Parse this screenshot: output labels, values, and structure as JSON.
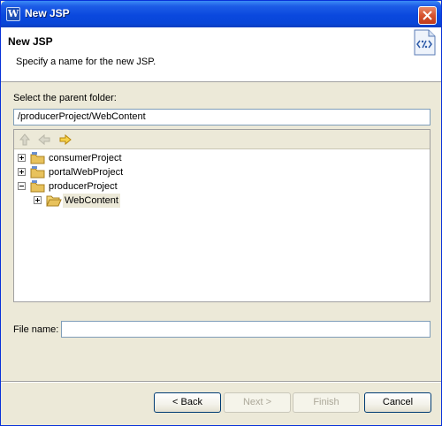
{
  "window": {
    "title": "New JSP",
    "app_icon_letter": "W",
    "close_icon": "close-icon"
  },
  "banner": {
    "title": "New JSP",
    "description": "Specify a name for the new JSP.",
    "icon": "jsp-file-icon"
  },
  "parent_folder": {
    "label": "Select the parent folder:",
    "value": "/producerProject/WebContent"
  },
  "tree": {
    "toolbar": {
      "up_icon": "up-arrow-icon",
      "back_icon": "back-arrow-icon",
      "forward_icon": "forward-arrow-icon"
    },
    "items": [
      {
        "label": "consumerProject",
        "expanded": false,
        "level": 0
      },
      {
        "label": "portalWebProject",
        "expanded": false,
        "level": 0
      },
      {
        "label": "producerProject",
        "expanded": true,
        "level": 0
      },
      {
        "label": "WebContent",
        "expanded": false,
        "level": 1,
        "selected": true
      }
    ]
  },
  "file_name": {
    "label": "File name:",
    "value": ""
  },
  "buttons": {
    "back": "< Back",
    "next": "Next >",
    "finish": "Finish",
    "cancel": "Cancel"
  },
  "colors": {
    "titlebar": "#0a48de",
    "dialog_bg": "#ece9d8",
    "folder": "#e8c25c"
  }
}
